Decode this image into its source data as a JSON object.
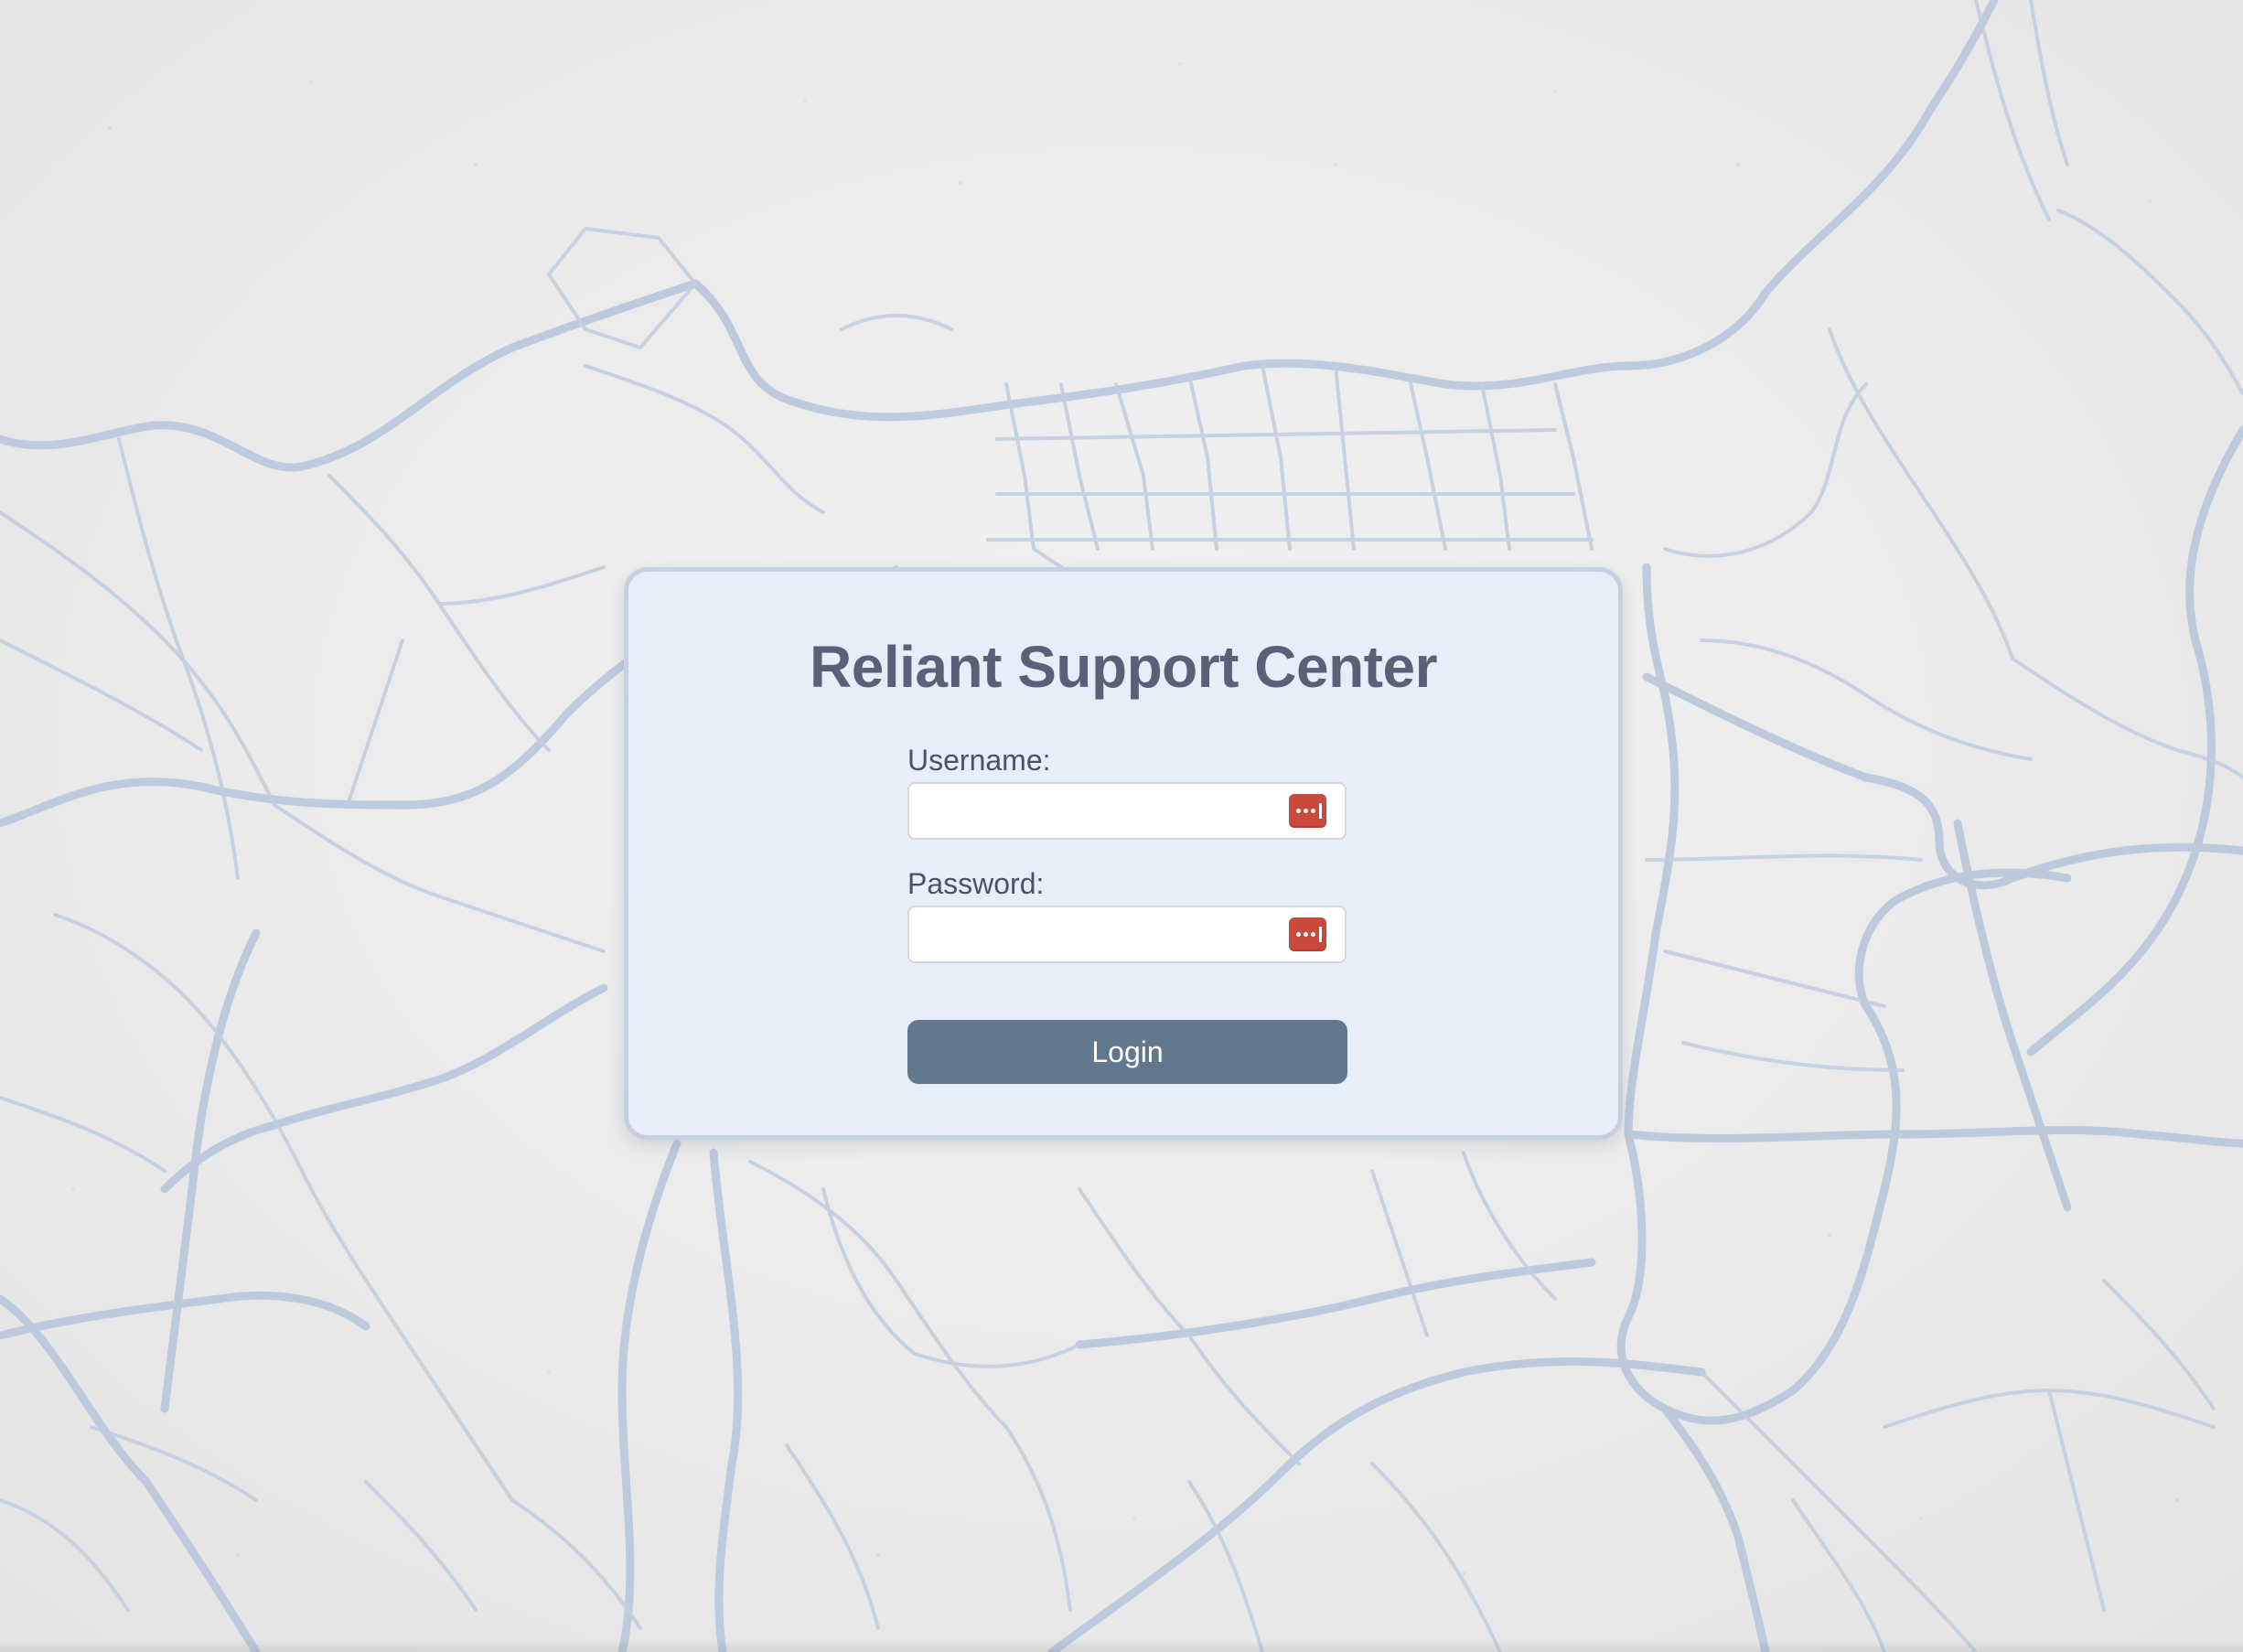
{
  "page": {
    "title": "Reliant Support Center"
  },
  "form": {
    "username_label": "Username:",
    "username_value": "",
    "password_label": "Password:",
    "password_value": "",
    "login_label": "Login"
  },
  "icons": {
    "username_field_icon": "password-manager-icon",
    "password_field_icon": "password-manager-icon"
  },
  "colors": {
    "card_background": "#e7eef9",
    "title_text": "#5b6078",
    "login_button": "#63778f",
    "password_manager_icon": "#c94a3c",
    "map_roads": "#b6c6dc"
  }
}
